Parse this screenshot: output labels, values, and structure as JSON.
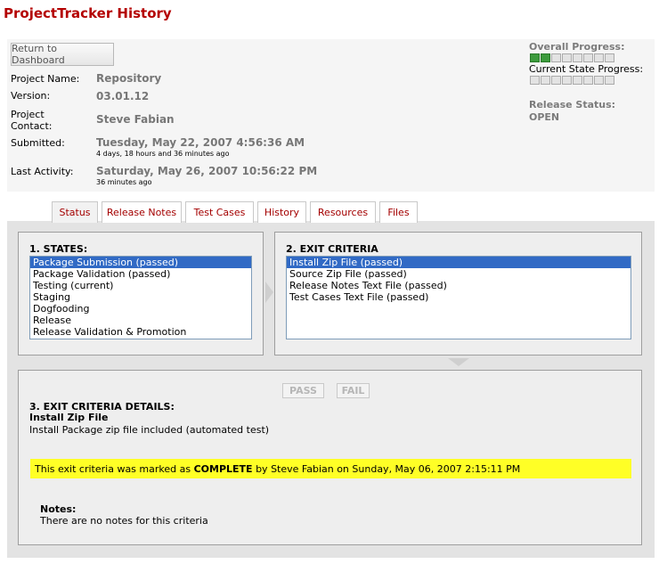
{
  "page_title": "ProjectTracker History",
  "dashboard_button": "Return to Dashboard",
  "project": {
    "name_label": "Project Name:",
    "name": "Repository",
    "version_label": "Version:",
    "version": "03.01.12",
    "contact_label_1": "Project",
    "contact_label_2": "Contact:",
    "contact": "Steve Fabian",
    "submitted_label": "Submitted:",
    "submitted": "Tuesday, May 22, 2007 4:56:36 AM",
    "submitted_ago": "4 days, 18 hours and 36 minutes ago",
    "last_activity_label": "Last Activity:",
    "last_activity": "Saturday, May 26, 2007 10:56:22 PM",
    "last_activity_ago": "36 minutes ago"
  },
  "progress": {
    "overall_label": "Overall Progress:",
    "overall_segments_total": 8,
    "overall_segments_complete": 2,
    "current_state_label": "Current State Progress:",
    "current_segments_total": 8,
    "current_segments_complete": 0,
    "release_status_label": "Release Status:",
    "release_status": "OPEN",
    "complete_color": "#3c9b3c"
  },
  "tabs": [
    {
      "label": "Status",
      "active": true
    },
    {
      "label": "Release Notes",
      "active": false
    },
    {
      "label": "Test Cases",
      "active": false
    },
    {
      "label": "History",
      "active": false
    },
    {
      "label": "Resources",
      "active": false
    },
    {
      "label": "Files",
      "active": false
    }
  ],
  "states": {
    "title": "1. STATES:",
    "items": [
      "Package Submission (passed)",
      "Package Validation (passed)",
      "Testing (current)",
      "Staging",
      "Dogfooding",
      "Release",
      "Release Validation & Promotion"
    ],
    "selected_index": 0
  },
  "exit_criteria": {
    "title": "2. EXIT CRITERIA",
    "items": [
      "Install Zip File (passed)",
      "Source Zip File (passed)",
      "Release Notes Text File (passed)",
      "Test Cases Text File (passed)"
    ],
    "selected_index": 0
  },
  "details": {
    "pass_label": "PASS",
    "fail_label": "FAIL",
    "title": "3. EXIT CRITERIA DETAILS:",
    "criteria_name": "Install Zip File",
    "criteria_desc": "Install Package zip file included (automated test)",
    "marked_prefix": "This exit criteria was marked as ",
    "marked_status": "COMPLETE",
    "marked_suffix": " by Steve Fabian on Sunday, May 06, 2007 2:15:11 PM",
    "highlight_color": "#ffff26",
    "notes_label": "Notes:",
    "notes_text": "There are no notes for this criteria"
  }
}
